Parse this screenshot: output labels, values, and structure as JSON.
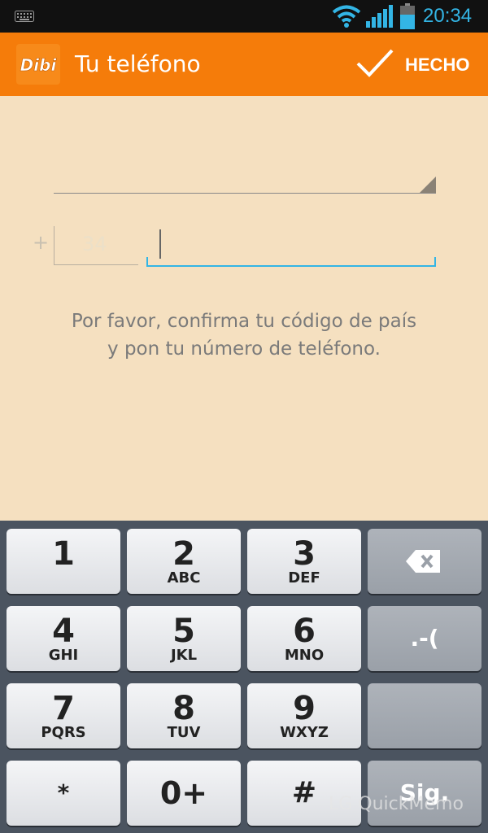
{
  "status_bar": {
    "time": "20:34"
  },
  "action_bar": {
    "logo_text": "Dibi",
    "title": "Tu teléfono",
    "done_label": "HECHO"
  },
  "form": {
    "country_value": "",
    "code_prefix": "+",
    "country_code": "34",
    "phone_value": ""
  },
  "instructions": {
    "line1": "Por favor, confirma tu código de país",
    "line2": "y pon tu número de teléfono."
  },
  "keyboard": {
    "keys": [
      {
        "main": "1",
        "sub": ""
      },
      {
        "main": "2",
        "sub": "ABC"
      },
      {
        "main": "3",
        "sub": "DEF"
      },
      {
        "main": "4",
        "sub": "GHI"
      },
      {
        "main": "5",
        "sub": "JKL"
      },
      {
        "main": "6",
        "sub": "MNO"
      },
      {
        "main": "7",
        "sub": "PQRS"
      },
      {
        "main": "8",
        "sub": "TUV"
      },
      {
        "main": "9",
        "sub": "WXYZ"
      },
      {
        "main": "*",
        "sub": ""
      },
      {
        "main": "0+",
        "sub": ""
      },
      {
        "main": "#",
        "sub": ""
      }
    ],
    "side_keys": {
      "backspace_icon": "backspace-icon",
      "punct": ".-(",
      "blank": "",
      "next": "Sig."
    }
  },
  "watermark": "LG QuickMemo",
  "colors": {
    "action_bar": "#f57c0a",
    "background": "#f5e0c0",
    "accent": "#33b5e5",
    "keyboard_bg": "#4b5460"
  }
}
